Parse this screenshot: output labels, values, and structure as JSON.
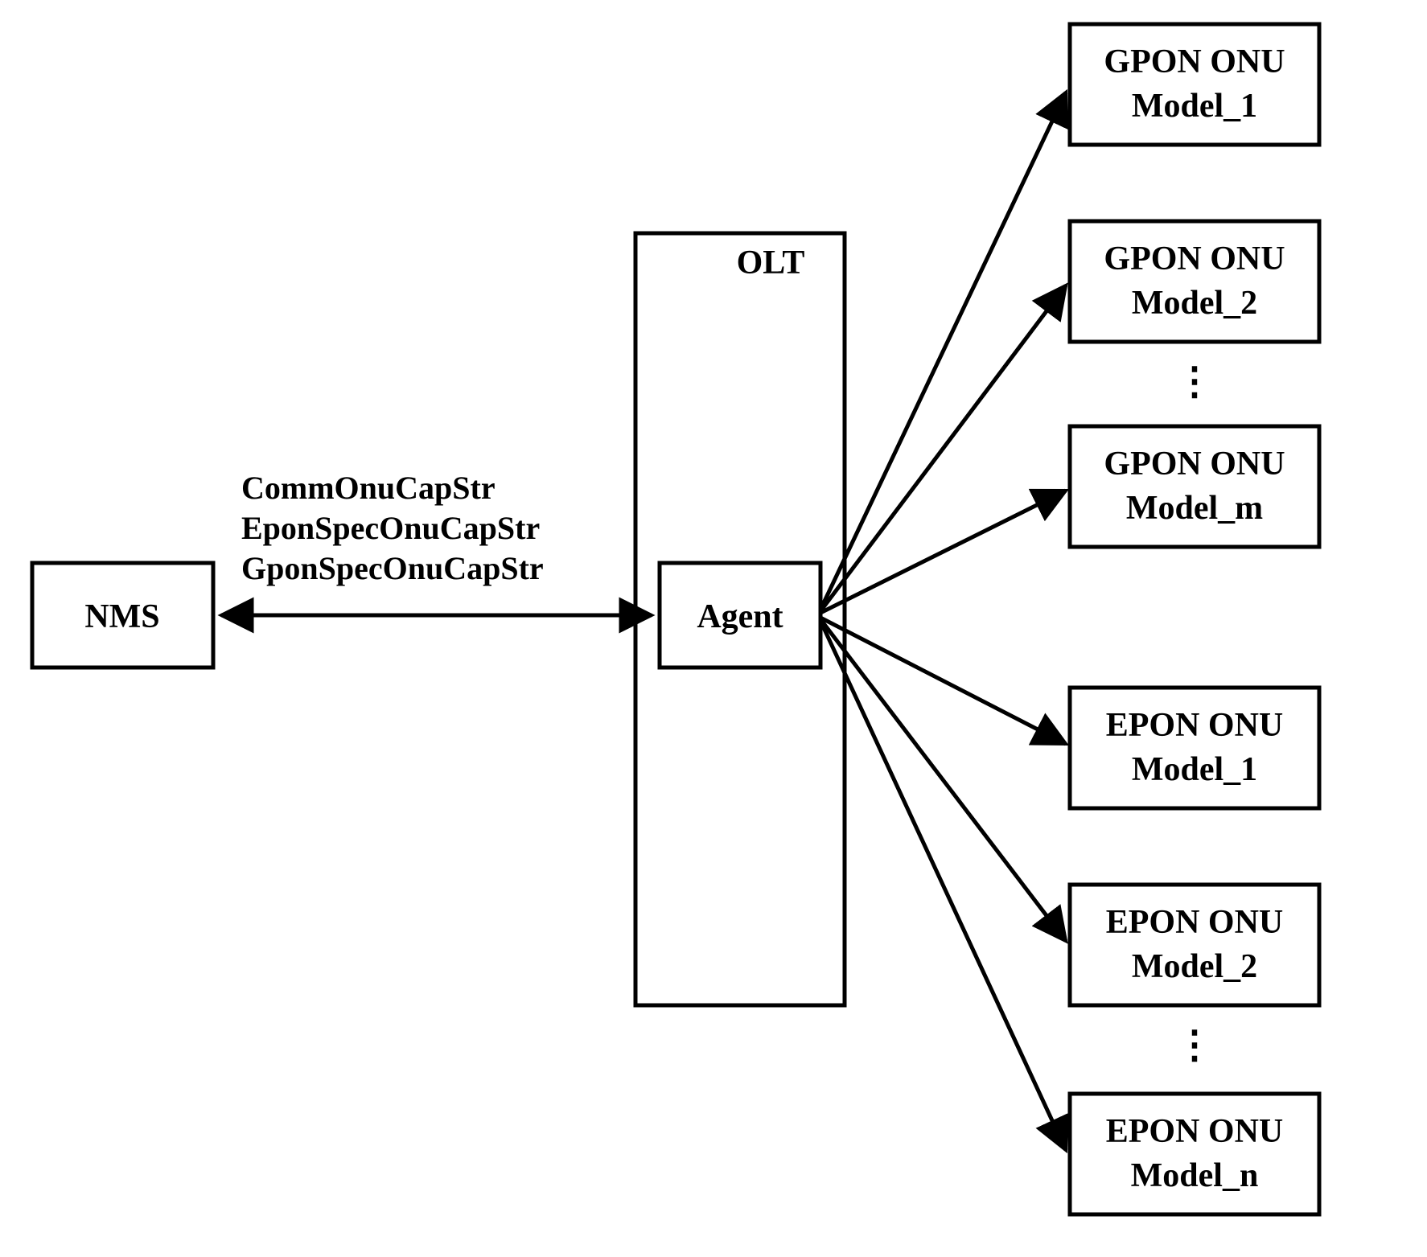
{
  "nms": {
    "label": "NMS"
  },
  "olt": {
    "label": "OLT"
  },
  "agent": {
    "label": "Agent"
  },
  "edge_labels": {
    "l1": "CommOnuCapStr",
    "l2": "EponSpecOnuCapStr",
    "l3": "GponSpecOnuCapStr"
  },
  "onu": {
    "gpon": {
      "a": {
        "line1": "GPON ONU",
        "line2": "Model_1"
      },
      "b": {
        "line1": "GPON ONU",
        "line2": "Model_2"
      },
      "m": {
        "line1": "GPON ONU",
        "line2": "Model_m"
      }
    },
    "epon": {
      "a": {
        "line1": "EPON ONU",
        "line2": "Model_1"
      },
      "b": {
        "line1": "EPON ONU",
        "line2": "Model_2"
      },
      "n": {
        "line1": "EPON ONU",
        "line2": "Model_n"
      }
    }
  },
  "ellipsis": "⋮"
}
